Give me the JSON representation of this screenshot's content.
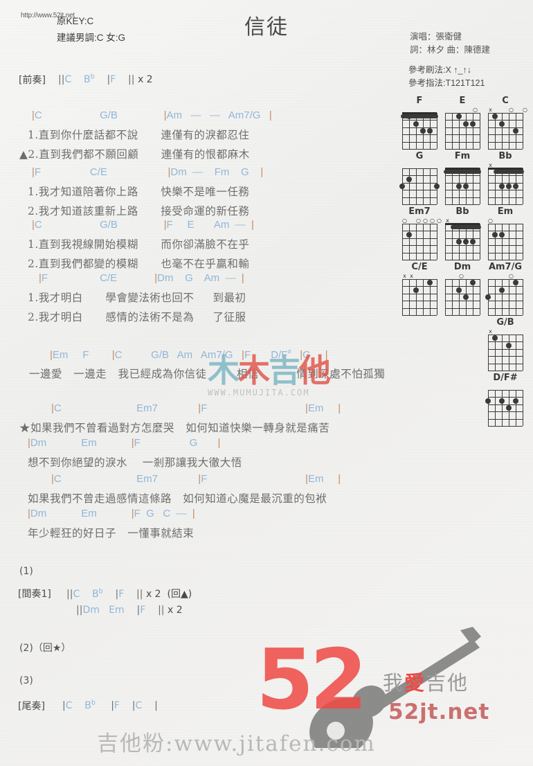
{
  "header": {
    "url_top": "http://www.52jt.net",
    "key_original": "原KEY:C",
    "key_suggested": "建議男調:C 女:G",
    "title": "信徒",
    "singer": "演唱：張衛健",
    "writers": "詞：林夕   曲：陳德建",
    "strum": "參考刷法:X ↑_↑↓",
    "fingering": "參考指法:T121T121"
  },
  "sections": {
    "intro_label": "[前奏]",
    "intro_chords": "||C    B♭    |F    || x 2",
    "interlude_label": "[間奏1]",
    "interlude_chords_1": "||C    B♭    |F    || x 2  (回▲)",
    "interlude_chords_2": "||Dm   Em    |F    || x 2",
    "outro_label": "[尾奏]",
    "outro_chords": "|C    B♭     |F    |C    |",
    "marker_1": "(1)",
    "marker_2": "(2)（回★）",
    "marker_3": "(3)"
  },
  "verses": [
    {
      "chords": "|C                    G/B                |Am   —   —   Am7/G   |",
      "lyric_1": "1.直到你什麼話都不說      連僅有的淚都忍住",
      "lyric_2": "▲2.直到我們都不願回顧      連僅有的恨都麻木"
    },
    {
      "chords": "|F                 C/E                     |Dm  —    Fm    G    |",
      "lyric_1": "1.我才知道陪著你上路      快樂不是唯一任務",
      "lyric_2": "2.我才知道該重新上路      接受命運的新任務"
    },
    {
      "chords": "|C                    G/B                |F     E       Am  —  |",
      "lyric_1": "1.直到我視線開始模糊      而你卻滿臉不在乎",
      "lyric_2": "2.直到我們都變的模糊      也毫不在乎贏和輸"
    },
    {
      "chords": "|F                  C/E             |Dm    G    Am  —  |",
      "lyric_1": "1.我才明白      學會變法術也回不     到最初",
      "lyric_2": "2.我才明白      感情的法術不是為     了征服"
    }
  ],
  "prechorus": {
    "chords": "|Em     F        |C          G/B   Am   Am7/G   |F       D/F#   |G     |",
    "lyric": "一邊愛   一邊走   我已經成為你信徒        相信          情到深處不怕孤獨"
  },
  "chorus": [
    {
      "chords": "|C                          Em7              |F                                  |Em     |",
      "lyric": "★如果我們不曾看過對方怎麼哭   如何知道快樂一轉身就是痛苦"
    },
    {
      "chords": "|Dm            Em            |F                 G       |",
      "lyric": "想不到你絕望的淚水    一剎那讓我大徹大悟"
    },
    {
      "chords": "|C                          Em7              |F                                  |Em     |",
      "lyric": "如果我們不曾走過感情這條路   如何知道心魔是最沉重的包袱"
    },
    {
      "chords": "|Dm            Em            |F  G   C  —  |",
      "lyric": "年少輕狂的好日子   一懂事就結束"
    }
  ],
  "chords_diagrams": [
    {
      "name": "F",
      "markers": [
        "",
        "",
        "",
        "",
        "",
        ""
      ],
      "barre": {
        "fret": 1,
        "from": 0,
        "to": 5
      },
      "dots": [
        {
          "s": 1,
          "f": 1
        },
        {
          "s": 2,
          "f": 2
        },
        {
          "s": 3,
          "f": 3
        },
        {
          "s": 4,
          "f": 3
        }
      ]
    },
    {
      "name": "E",
      "markers": [
        "",
        "",
        "",
        "",
        "o",
        ""
      ],
      "dots": [
        {
          "s": 2,
          "f": 1
        },
        {
          "s": 3,
          "f": 2
        },
        {
          "s": 4,
          "f": 2
        }
      ]
    },
    {
      "name": "C",
      "markers": [
        "x",
        "",
        "",
        "o",
        "",
        "o"
      ],
      "dots": [
        {
          "s": 1,
          "f": 1
        },
        {
          "s": 2,
          "f": 2
        },
        {
          "s": 4,
          "f": 3
        }
      ]
    },
    {
      "name": "G",
      "markers": [
        "",
        "",
        "",
        "",
        "",
        ""
      ],
      "dots": [
        {
          "s": 0,
          "f": 3
        },
        {
          "s": 1,
          "f": 2
        },
        {
          "s": 5,
          "f": 3
        }
      ]
    },
    {
      "name": "Fm",
      "markers": [
        "",
        "",
        "",
        "",
        "",
        ""
      ],
      "barre": {
        "fret": 1,
        "from": 0,
        "to": 5
      },
      "dots": [
        {
          "s": 2,
          "f": 3
        },
        {
          "s": 3,
          "f": 3
        }
      ]
    },
    {
      "name": "Bb",
      "markers": [
        "x",
        "",
        "",
        "",
        "",
        ""
      ],
      "barre": {
        "fret": 1,
        "from": 1,
        "to": 5
      },
      "dots": [
        {
          "s": 2,
          "f": 3
        },
        {
          "s": 3,
          "f": 3
        },
        {
          "s": 4,
          "f": 3
        }
      ]
    },
    {
      "name": "Em7",
      "markers": [
        "o",
        "",
        "o",
        "o",
        "o",
        "o"
      ],
      "dots": [
        {
          "s": 1,
          "f": 2
        }
      ]
    },
    {
      "name": "Bb",
      "markers": [
        "x",
        "",
        "",
        "",
        "",
        ""
      ],
      "barre": {
        "fret": 1,
        "from": 1,
        "to": 5
      },
      "dots": [
        {
          "s": 2,
          "f": 3
        },
        {
          "s": 3,
          "f": 3
        },
        {
          "s": 4,
          "f": 3
        }
      ]
    },
    {
      "name": "Em",
      "markers": [
        "o",
        "",
        "",
        "",
        "",
        ""
      ],
      "dots": [
        {
          "s": 1,
          "f": 2
        },
        {
          "s": 2,
          "f": 2
        }
      ]
    },
    {
      "name": "C/E",
      "markers": [
        "x",
        "x",
        "",
        "",
        "",
        ""
      ],
      "dots": [
        {
          "s": 2,
          "f": 2
        },
        {
          "s": 4,
          "f": 1
        }
      ]
    },
    {
      "name": "Dm",
      "markers": [
        "",
        "",
        "o",
        "",
        "",
        ""
      ],
      "dots": [
        {
          "s": 2,
          "f": 2
        },
        {
          "s": 3,
          "f": 3
        },
        {
          "s": 4,
          "f": 1
        }
      ]
    },
    {
      "name": "Am7/G",
      "markers": [
        "",
        "",
        "",
        "o",
        "",
        ""
      ],
      "dots": [
        {
          "s": 0,
          "f": 3
        },
        {
          "s": 2,
          "f": 2
        },
        {
          "s": 4,
          "f": 1
        }
      ]
    },
    {
      "name": "G/B",
      "markers": [
        "x",
        "",
        "",
        "",
        "",
        ""
      ],
      "dots": [
        {
          "s": 1,
          "f": 1
        },
        {
          "s": 3,
          "f": 2
        }
      ]
    },
    {
      "name": "D/F#",
      "markers": [
        "",
        "",
        "",
        "",
        "",
        ""
      ],
      "dots": [
        {
          "s": 0,
          "f": 2
        },
        {
          "s": 2,
          "f": 2
        },
        {
          "s": 3,
          "f": 3
        },
        {
          "s": 4,
          "f": 2
        }
      ]
    }
  ],
  "watermarks": {
    "mumu_text": "木木吉他",
    "mumu_url": "WWW.MUMUJITA.COM",
    "fiftytwo_num": "52",
    "fiftytwo_cn": "我愛吉他",
    "fiftytwo_domain": "52jt.net",
    "bottom": "吉他粉:www.jitafen.com"
  },
  "colors": {
    "chord": "#8fb6d8",
    "lyric": "#6d6d6d",
    "bar": "#c98a5e",
    "accent_red": "#ef4a44"
  }
}
